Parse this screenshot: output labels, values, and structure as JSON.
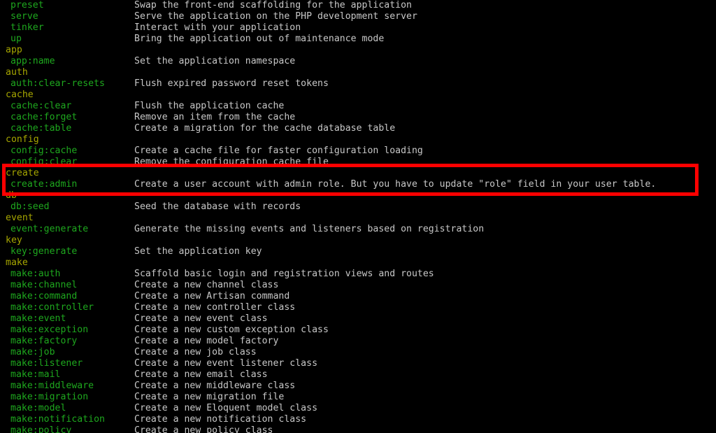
{
  "terminal": {
    "background_color": "#000000",
    "command_color": "#1ea81e",
    "group_color": "#a6a600",
    "description_color": "#c8c8c8",
    "highlight_color": "#ff0000"
  },
  "lines": [
    {
      "type": "command",
      "name": "preset",
      "description": "Swap the front-end scaffolding for the application"
    },
    {
      "type": "command",
      "name": "serve",
      "description": "Serve the application on the PHP development server"
    },
    {
      "type": "command",
      "name": "tinker",
      "description": "Interact with your application"
    },
    {
      "type": "command",
      "name": "up",
      "description": "Bring the application out of maintenance mode"
    },
    {
      "type": "group",
      "name": "app"
    },
    {
      "type": "command",
      "name": "app:name",
      "description": "Set the application namespace"
    },
    {
      "type": "group",
      "name": "auth"
    },
    {
      "type": "command",
      "name": "auth:clear-resets",
      "description": "Flush expired password reset tokens"
    },
    {
      "type": "group",
      "name": "cache"
    },
    {
      "type": "command",
      "name": "cache:clear",
      "description": "Flush the application cache"
    },
    {
      "type": "command",
      "name": "cache:forget",
      "description": "Remove an item from the cache"
    },
    {
      "type": "command",
      "name": "cache:table",
      "description": "Create a migration for the cache database table"
    },
    {
      "type": "group",
      "name": "config"
    },
    {
      "type": "command",
      "name": "config:cache",
      "description": "Create a cache file for faster configuration loading"
    },
    {
      "type": "command",
      "name": "config:clear",
      "description": "Remove the configuration cache file"
    },
    {
      "type": "group",
      "name": "create"
    },
    {
      "type": "command",
      "name": "create:admin",
      "description": "Create a user account with admin role. But you have to update \"role\" field in your user table."
    },
    {
      "type": "group",
      "name": "db"
    },
    {
      "type": "command",
      "name": "db:seed",
      "description": "Seed the database with records"
    },
    {
      "type": "group",
      "name": "event"
    },
    {
      "type": "command",
      "name": "event:generate",
      "description": "Generate the missing events and listeners based on registration"
    },
    {
      "type": "group",
      "name": "key"
    },
    {
      "type": "command",
      "name": "key:generate",
      "description": "Set the application key"
    },
    {
      "type": "group",
      "name": "make"
    },
    {
      "type": "command",
      "name": "make:auth",
      "description": "Scaffold basic login and registration views and routes"
    },
    {
      "type": "command",
      "name": "make:channel",
      "description": "Create a new channel class"
    },
    {
      "type": "command",
      "name": "make:command",
      "description": "Create a new Artisan command"
    },
    {
      "type": "command",
      "name": "make:controller",
      "description": "Create a new controller class"
    },
    {
      "type": "command",
      "name": "make:event",
      "description": "Create a new event class"
    },
    {
      "type": "command",
      "name": "make:exception",
      "description": "Create a new custom exception class"
    },
    {
      "type": "command",
      "name": "make:factory",
      "description": "Create a new model factory"
    },
    {
      "type": "command",
      "name": "make:job",
      "description": "Create a new job class"
    },
    {
      "type": "command",
      "name": "make:listener",
      "description": "Create a new event listener class"
    },
    {
      "type": "command",
      "name": "make:mail",
      "description": "Create a new email class"
    },
    {
      "type": "command",
      "name": "make:middleware",
      "description": "Create a new middleware class"
    },
    {
      "type": "command",
      "name": "make:migration",
      "description": "Create a new migration file"
    },
    {
      "type": "command",
      "name": "make:model",
      "description": "Create a new Eloquent model class"
    },
    {
      "type": "command",
      "name": "make:notification",
      "description": "Create a new notification class"
    },
    {
      "type": "command",
      "name": "make:policy",
      "description": "Create a new policy class"
    }
  ],
  "highlight": {
    "label": "create-admin-highlight",
    "covers": [
      "create",
      "create:admin",
      "db"
    ]
  }
}
